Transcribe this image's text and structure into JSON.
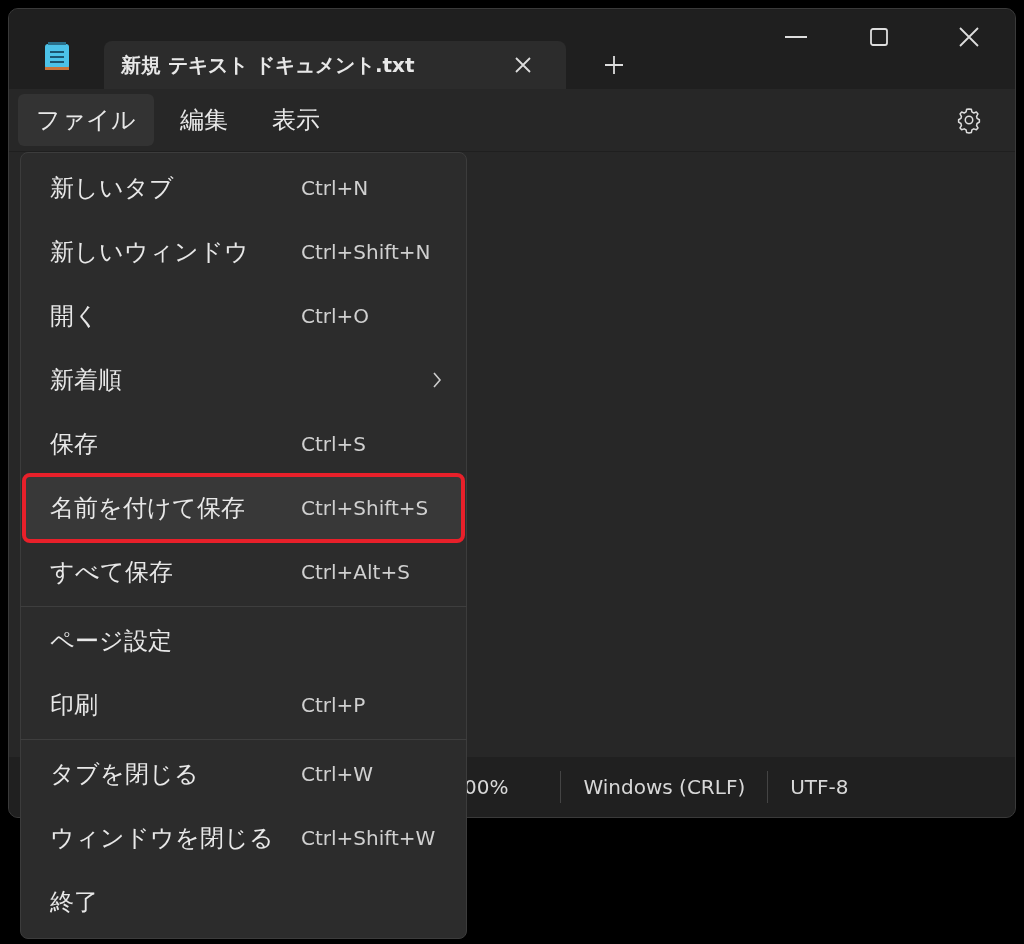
{
  "tab": {
    "title": "新規 テキスト ドキュメント.txt",
    "selected": true
  },
  "menubar": [
    {
      "label": "ファイル",
      "selected": true
    },
    {
      "label": "編集",
      "selected": false
    },
    {
      "label": "表示",
      "selected": false
    }
  ],
  "status_bar": [
    "00%",
    "Windows (CRLF)",
    "UTF-8"
  ],
  "file_menu": [
    {
      "kind": "item",
      "label": "新しいタブ",
      "shortcut": "Ctrl+N",
      "selected": false
    },
    {
      "kind": "item",
      "label": "新しいウィンドウ",
      "shortcut": "Ctrl+Shift+N",
      "selected": false
    },
    {
      "kind": "item",
      "label": "開く",
      "shortcut": "Ctrl+O",
      "selected": false
    },
    {
      "kind": "submenu",
      "label": "新着順",
      "selected": false
    },
    {
      "kind": "item",
      "label": "保存",
      "shortcut": "Ctrl+S",
      "selected": false
    },
    {
      "kind": "item",
      "label": "名前を付けて保存",
      "shortcut": "Ctrl+Shift+S",
      "selected": true
    },
    {
      "kind": "item",
      "label": "すべて保存",
      "shortcut": "Ctrl+Alt+S",
      "selected": false
    },
    {
      "kind": "separator"
    },
    {
      "kind": "item",
      "label": "ページ設定",
      "selected": false
    },
    {
      "kind": "item",
      "label": "印刷",
      "shortcut": "Ctrl+P",
      "selected": false
    },
    {
      "kind": "separator"
    },
    {
      "kind": "item",
      "label": "タブを閉じる",
      "shortcut": "Ctrl+W",
      "selected": false
    },
    {
      "kind": "item",
      "label": "ウィンドウを閉じる",
      "shortcut": "Ctrl+Shift+W",
      "selected": false
    },
    {
      "kind": "item",
      "label": "終了",
      "selected": false
    }
  ]
}
